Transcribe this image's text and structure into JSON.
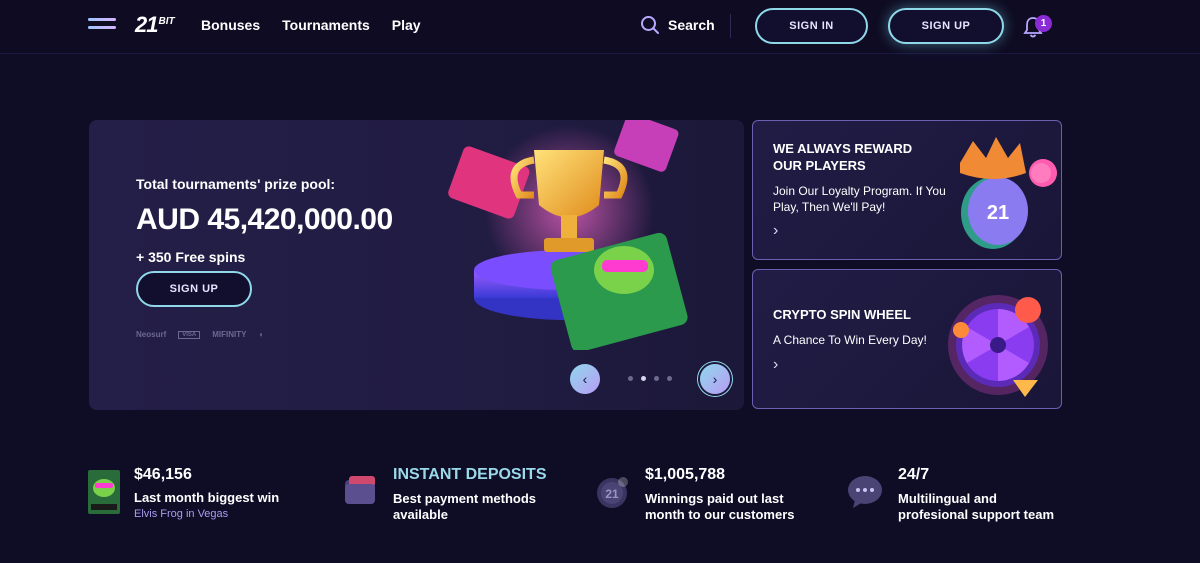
{
  "header": {
    "logo": "21",
    "logo_small": "BIT",
    "nav": [
      "Bonuses",
      "Tournaments",
      "Play"
    ],
    "search_label": "Search",
    "sign_in": "SIGN IN",
    "sign_up": "SIGN UP",
    "notification_count": "1"
  },
  "hero": {
    "subtitle": "Total tournaments' prize pool:",
    "amount": "AUD 45,420,000.00",
    "spins": "+ 350 Free spins",
    "button": "SIGN UP",
    "payment_logos": [
      "Neosurf",
      "VISA",
      "MIFINITY"
    ],
    "slides": 4,
    "active_slide": 2
  },
  "cards": [
    {
      "title": "WE ALWAYS REWARD OUR PLAYERS",
      "text": "Join Our Loyalty Program. If You Play, Then We'll Pay!",
      "chip_text": "21"
    },
    {
      "title": "CRYPTO SPIN WHEEL",
      "text": "A Chance To Win Every Day!"
    }
  ],
  "stats": [
    {
      "value": "$46,156",
      "label": "Last month biggest win",
      "sub": "Elvis Frog in Vegas",
      "icon": "slot-thumbnail-icon"
    },
    {
      "value": "INSTANT DEPOSITS",
      "label": "Best payment methods\navailable",
      "icon": "wallet-icon"
    },
    {
      "value": "$1,005,788",
      "label": "Winnings paid out last\nmonth to our customers",
      "icon": "coin-icon"
    },
    {
      "value": "24/7",
      "label": "Multilingual and\nprofesional support team",
      "icon": "chat-bubble-icon"
    }
  ],
  "colors": {
    "background": "#0f0c26",
    "accent_cyan": "#8fd8e9",
    "accent_purple": "#8b2bd6",
    "link_purple": "#a99cf0"
  }
}
